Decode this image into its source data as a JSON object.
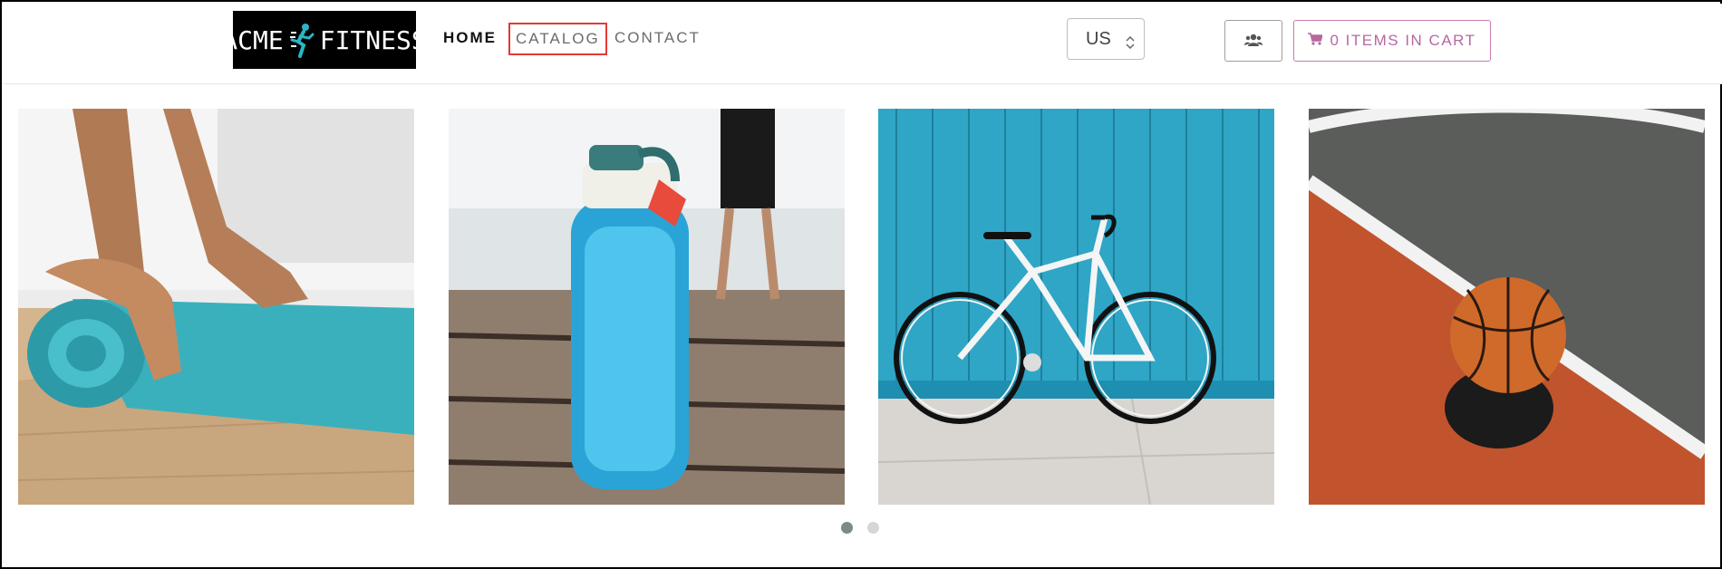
{
  "brand": {
    "logo_left": "ACME",
    "logo_right": "FITNESS"
  },
  "nav": {
    "home": "HOME",
    "catalog": "CATALOG",
    "contact": "CONTACT"
  },
  "region_select": {
    "value": "US"
  },
  "cart": {
    "label": "0 ITEMS IN CART"
  },
  "carousel": {
    "slides": [
      {
        "name": "yoga-mat",
        "icon": "yoga-mat-photo"
      },
      {
        "name": "water-bottle",
        "icon": "water-bottle-photo"
      },
      {
        "name": "bicycle",
        "icon": "bicycle-photo"
      },
      {
        "name": "basketball",
        "icon": "basketball-photo"
      }
    ],
    "page_count": 2,
    "active_page": 1
  },
  "colors": {
    "catalog_highlight": "#e53935",
    "cart_accent": "#b8679f",
    "teal": "#2aa6c6"
  }
}
